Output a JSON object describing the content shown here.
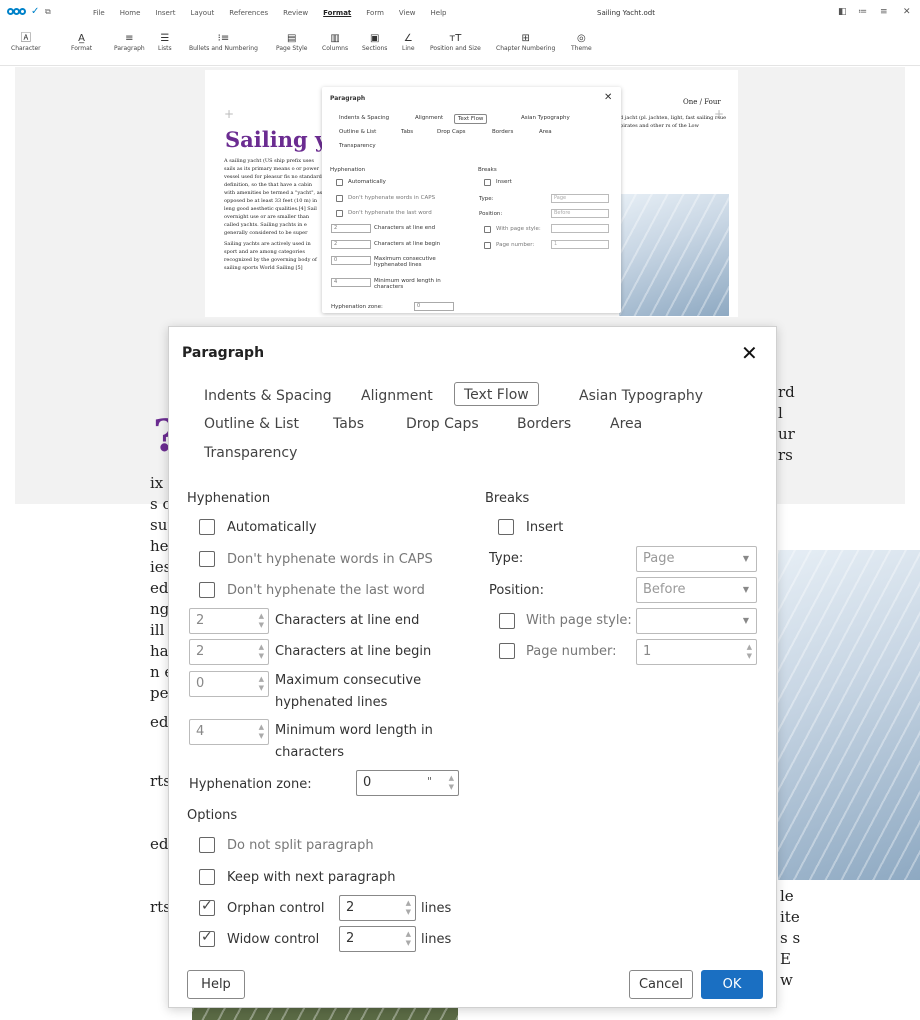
{
  "app": {
    "menu": [
      "File",
      "Home",
      "Insert",
      "Layout",
      "References",
      "Review",
      "Format",
      "Form",
      "View",
      "Help"
    ],
    "active_menu": "Format",
    "document_title": "Sailing Yacht.odt"
  },
  "ribbon": [
    {
      "label": "Character",
      "icon": "character-icon"
    },
    {
      "label": "Format",
      "icon": "format-icon"
    },
    {
      "label": "Paragraph",
      "icon": "paragraph-icon"
    },
    {
      "label": "Lists",
      "icon": "lists-icon"
    },
    {
      "label": "Bullets and Numbering",
      "icon": "bullets-icon"
    },
    {
      "label": "Page Style",
      "icon": "page-style-icon"
    },
    {
      "label": "Columns",
      "icon": "columns-icon"
    },
    {
      "label": "Sections",
      "icon": "sections-icon"
    },
    {
      "label": "Line",
      "icon": "line-icon"
    },
    {
      "label": "Position and Size",
      "icon": "position-size-icon"
    },
    {
      "label": "Chapter Numbering",
      "icon": "chapter-numbering-icon"
    },
    {
      "label": "Theme",
      "icon": "theme-icon"
    }
  ],
  "page": {
    "page_number": "One / Four",
    "title": "Sailing ya",
    "body_p1": "A sailing yacht (US ship prefix uses sails as its primary means o or power vessel used for pleasur fis no standard definition, so the that have a cabin with amenities be termed a \"yacht\", as opposed be at least 33 feet (10 m) in leng good aesthetic qualities.[4] Sail overnight use or are smaller than called yachts. Sailing yachts in e generally considered to be super",
    "body_p2": "Sailing yachts are actively used in sport and are among categories recognized by the governing body of sailing sports World Sailing [5]",
    "right_text": "d jacht (pl. jachten, light, fast sailing rsue pirates and other rs of the Low"
  },
  "small_dialog": {
    "title": "Paragraph",
    "tabs_row1": [
      "Indents & Spacing",
      "Alignment",
      "Text Flow",
      "Asian Typography"
    ],
    "tabs_row2": [
      "Outline & List",
      "Tabs",
      "Drop Caps",
      "Borders",
      "Area"
    ],
    "tabs_row3": [
      "Transparency"
    ],
    "hyphenation": "Hyphenation",
    "automatically": "Automatically",
    "no_caps": "Don't hyphenate words in CAPS",
    "no_last": "Don't hyphenate the last word",
    "chars_end": "Characters at line end",
    "chars_begin": "Characters at line begin",
    "max_hyph": "Maximum consecutive hyphenated lines",
    "min_word": "Minimum word length in characters",
    "zone": "Hyphenation zone:",
    "breaks": "Breaks",
    "insert": "Insert",
    "type": "Type:",
    "position": "Position:",
    "with_style": "With page style:",
    "page_number": "Page number:"
  },
  "dialog": {
    "title": "Paragraph",
    "tabs": [
      {
        "label": "Indents & Spacing",
        "active": false
      },
      {
        "label": "Alignment",
        "active": false
      },
      {
        "label": "Text Flow",
        "active": true
      },
      {
        "label": "Asian Typography",
        "active": false
      },
      {
        "label": "Outline & List",
        "active": false
      },
      {
        "label": "Tabs",
        "active": false
      },
      {
        "label": "Drop Caps",
        "active": false
      },
      {
        "label": "Borders",
        "active": false
      },
      {
        "label": "Area",
        "active": false
      },
      {
        "label": "Transparency",
        "active": false
      }
    ],
    "hyphenation": {
      "heading": "Hyphenation",
      "automatically": {
        "label": "Automatically",
        "checked": false
      },
      "no_caps": {
        "label": "Don't hyphenate words in CAPS",
        "checked": false
      },
      "no_last_word": {
        "label": "Don't hyphenate the last word",
        "checked": false
      },
      "chars_line_end": {
        "value": "2",
        "label": "Characters at line end"
      },
      "chars_line_begin": {
        "value": "2",
        "label": "Characters at line begin"
      },
      "max_consecutive": {
        "value": "0",
        "label_1": "Maximum consecutive",
        "label_2": "hyphenated lines"
      },
      "min_word_length": {
        "value": "4",
        "label_1": "Minimum word length in",
        "label_2": "characters"
      },
      "zone": {
        "label": "Hyphenation zone:",
        "value": "0",
        "unit": "\""
      }
    },
    "breaks": {
      "heading": "Breaks",
      "insert": {
        "label": "Insert",
        "checked": false
      },
      "type": {
        "label": "Type:",
        "value": "Page"
      },
      "position": {
        "label": "Position:",
        "value": "Before"
      },
      "with_page_style": {
        "label": "With page style:",
        "checked": false,
        "value": ""
      },
      "page_number": {
        "label": "Page number:",
        "checked": false,
        "value": "1"
      }
    },
    "options": {
      "heading": "Options",
      "do_not_split": {
        "label": "Do not split paragraph",
        "checked": false
      },
      "keep_with_next": {
        "label": "Keep with next paragraph",
        "checked": false
      },
      "orphan": {
        "label": "Orphan control",
        "checked": true,
        "value": "2",
        "unit": "lines"
      },
      "widow": {
        "label": "Widow control",
        "checked": true,
        "value": "2",
        "unit": "lines"
      }
    },
    "buttons": {
      "help": "Help",
      "cancel": "Cancel",
      "ok": "OK"
    }
  },
  "background_text": {
    "right": [
      "rd",
      "l",
      "ur",
      "rs"
    ],
    "right_lower": [
      "le",
      "ite",
      "s s",
      "E",
      "w"
    ],
    "left": [
      "ix",
      "s c",
      "sur",
      "he",
      "ies",
      "ed",
      "ng",
      "ill",
      "har",
      "n e",
      "per",
      "ed",
      "rts",
      "ed",
      "rts"
    ]
  },
  "colors": {
    "accent": "#0082c9",
    "title_purple": "#6b2c91",
    "ok_blue": "#1a6fc2"
  }
}
